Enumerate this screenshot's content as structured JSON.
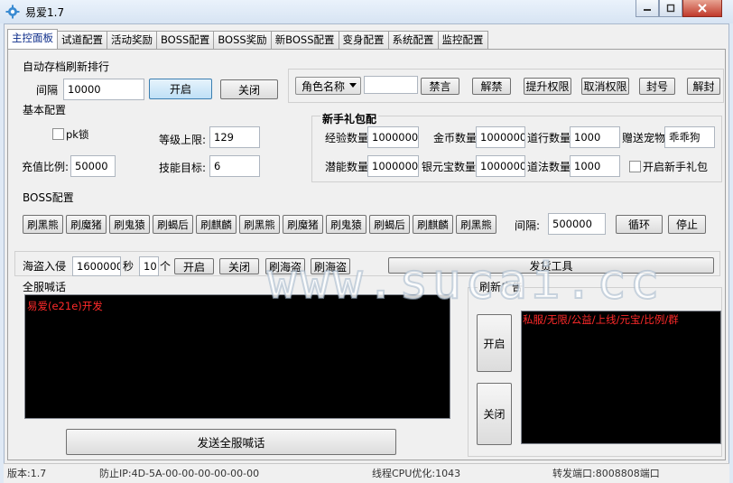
{
  "window": {
    "title": "易爱1.7"
  },
  "tabs": [
    {
      "label": "主控面板"
    },
    {
      "label": "试道配置"
    },
    {
      "label": "活动奖励"
    },
    {
      "label": "BOSS配置"
    },
    {
      "label": "BOSS奖励"
    },
    {
      "label": "新BOSS配置"
    },
    {
      "label": "变身配置"
    },
    {
      "label": "系统配置"
    },
    {
      "label": "监控配置"
    }
  ],
  "autosave": {
    "title": "自动存档刷新排行",
    "interval_label": "间隔",
    "interval_value": "10000",
    "start_label": "开启",
    "stop_label": "关闭"
  },
  "role": {
    "combo_value": "角色名称",
    "name_value": "",
    "buttons": [
      "禁言",
      "解禁",
      "提升权限",
      "取消权限",
      "封号",
      "解封"
    ]
  },
  "basic": {
    "title": "基本配置",
    "pk_label": "pk锁",
    "level_label": "等级上限:",
    "level_value": "129",
    "recharge_label": "充值比例:",
    "recharge_value": "50000",
    "skill_label": "技能目标:",
    "skill_value": "6"
  },
  "newbie": {
    "title": "新手礼包配",
    "exp_label": "经验数量",
    "exp_value": "1000000",
    "gold_label": "金币数量",
    "gold_value": "1000000",
    "dao_label": "道行数量",
    "dao_value": "1000",
    "pet_label": "赠送宠物",
    "pet_value": "乖乖狗",
    "potential_label": "潜能数量",
    "potential_value": "1000000",
    "silver_label": "银元宝数量",
    "silver_value": "1000000",
    "daofa_label": "道法数量",
    "daofa_value": "1000",
    "enable_label": "开启新手礼包"
  },
  "boss": {
    "title": "BOSS配置",
    "buttons": [
      "刷黑熊",
      "刷魔猪",
      "刷鬼猿",
      "刷蝎后",
      "刷麒麟",
      "刷黑熊",
      "刷魔猪",
      "刷鬼猿",
      "刷蝎后",
      "刷麒麟",
      "刷黑熊"
    ],
    "interval_label": "间隔:",
    "interval_value": "500000",
    "loop_label": "循环",
    "stop_label": "停止"
  },
  "pirate": {
    "label": "海盗入侵",
    "seconds_value": "1600000",
    "seconds_unit": "秒",
    "count_value": "10",
    "count_unit": "个",
    "start_label": "开启",
    "stop_label": "关闭",
    "spawn1_label": "刷海盗",
    "spawn2_label": "刷海盗",
    "shipping_label": "发货工具"
  },
  "broadcast": {
    "title": "全服喊话",
    "content": "易爱(e21e)开发",
    "send_label": "发送全服喊话"
  },
  "ad": {
    "title": "刷新广告",
    "start_label": "开启",
    "stop_label": "关闭",
    "content": "私服/无限/公益/上线/元宝/比例/群"
  },
  "statusbar": {
    "version": "版本:1.7",
    "guard": "防止IP:4D-5A-00-00-00-00-00-00",
    "thread": "线程CPU优化:1043",
    "port": "转发端口:8008808端口"
  },
  "watermark": "www.sucai.cc",
  "colors": {
    "accent": "#3c7fb1",
    "chat_text": "#ff2a2a",
    "chat_bg": "#000000"
  }
}
